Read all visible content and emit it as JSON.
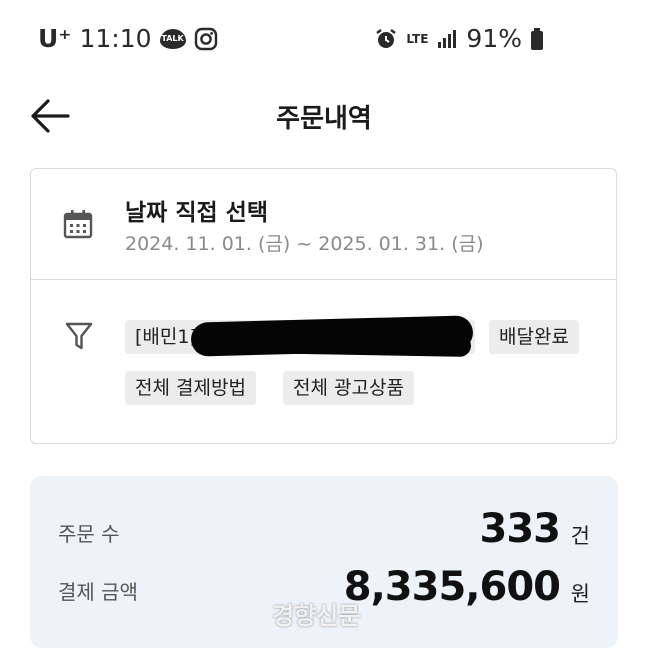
{
  "status_bar": {
    "carrier": "U⁺",
    "time": "11:10",
    "talk_badge": "TALK",
    "network": "LTE",
    "battery": "91%"
  },
  "header": {
    "title": "주문내역"
  },
  "date_filter": {
    "title": "날짜 직접 선택",
    "range": "2024. 11. 01. (금) ~ 2025. 01. 31. (금)"
  },
  "filter_chips": [
    {
      "label": "[배민1] 한 ... 전"
    },
    {
      "label": "배달완료"
    },
    {
      "label": "전체 결제방법"
    },
    {
      "label": "전체 광고상품"
    }
  ],
  "summary": {
    "order_count_label": "주문 수",
    "order_count_value": "333",
    "order_count_unit": "건",
    "payment_label": "결제 금액",
    "payment_value": "8,335,600",
    "payment_unit": "원"
  },
  "watermark": "경향신문",
  "colors": {
    "summary_bg": "#eef2f9",
    "chip_bg": "#ececec",
    "border": "#dcdcdc"
  }
}
